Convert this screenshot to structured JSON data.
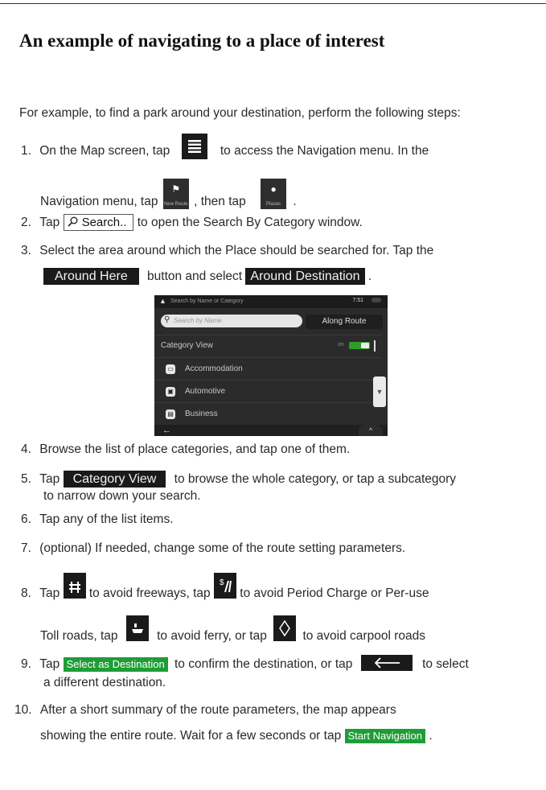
{
  "heading": "An example of navigating to a place of interest",
  "intro": "For example, to find a park around your destination, perform the following steps:",
  "steps": {
    "s1_num": "1.",
    "s1_a": "On the Map screen, tap",
    "s1_b": "to access the Navigation menu. In the",
    "s1_c": "Navigation menu, tap",
    "s1_d": ", then tap",
    "s1_e": ".",
    "new_route_label": "New Route",
    "places_label": "Places",
    "s2_num": "2.",
    "s2_a": "Tap",
    "search_btn": "Search..",
    "s2_b": "to open the Search By Category window.",
    "s3_num": "3.",
    "s3_a": "Select the area around which the Place should be searched for. Tap the",
    "around_here": "Around Here",
    "s3_b": "button and select",
    "around_destination": "Around Destination",
    "s3_c": ".",
    "s4_num": "4.",
    "s4_a": "Browse the list of place categories, and tap one of them.",
    "s5_num": "5.",
    "s5_a": "Tap",
    "category_view": "Category View",
    "s5_b": "to browse the whole category, or tap a subcategory",
    "s5_c": "to narrow down your search.",
    "s6_num": "6.",
    "s6_a": "Tap any of the list items.",
    "s7_num": "7.",
    "s7_a": "(optional) If needed, change some of the route setting parameters.",
    "s8_num": "8.",
    "s8_a": "Tap",
    "s8_b": "to avoid freeways, tap",
    "s8_c": "to avoid Period Charge or Per-use",
    "s8_d": "Toll roads, tap",
    "s8_e": "to  avoid ferry,  or tap",
    "s8_f": "to avoid carpool roads",
    "s9_num": "9.",
    "s9_a": "Tap",
    "select_as_destination": "Select as Destination",
    "s9_b": "to confirm the destination, or tap",
    "s9_c": "to select",
    "s9_d": "a different destination.",
    "s10_num": "10.",
    "s10_a": "After a short summary of the route parameters, the map appears",
    "s10_b": "showing the entire route. Wait for  a few seconds or tap",
    "start_navigation": "Start Navigation",
    "s10_c": "."
  },
  "screenshot": {
    "title": "Search by Name or Category",
    "time": "7:51",
    "search_placeholder": "Search by Name",
    "along_route": "Along Route",
    "category_view": "Category View",
    "toggle_state": "on",
    "items": [
      "Accommodation",
      "Automotive",
      "Business"
    ]
  },
  "colors": {
    "dark_button": "#1a1a1a",
    "green_button": "#1e9d36"
  }
}
